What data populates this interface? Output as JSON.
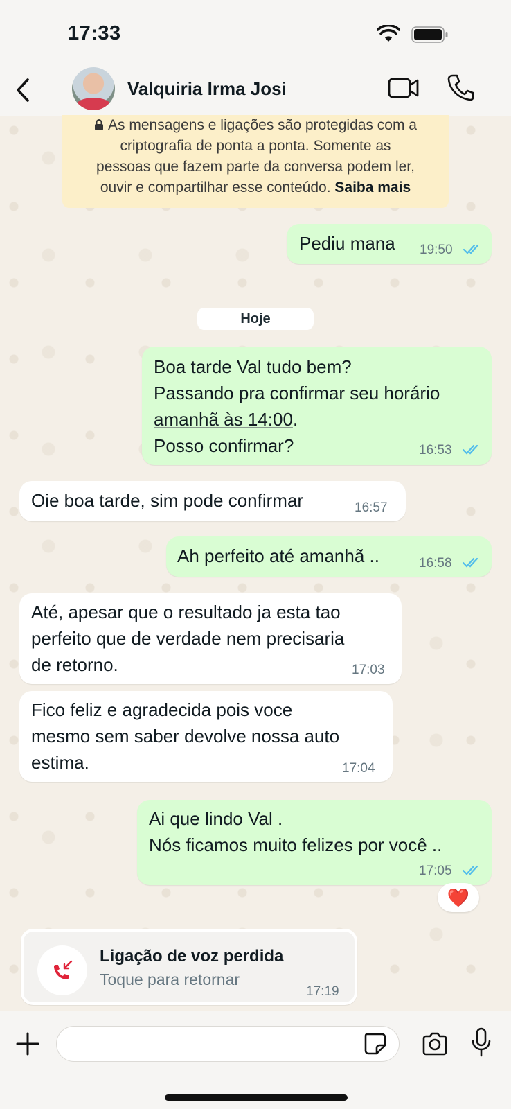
{
  "status_bar": {
    "time": "17:33"
  },
  "header": {
    "contact_name": "Valquiria Irma Josi"
  },
  "encryption_notice": {
    "line1": "As mensagens e ligações são protegidas com a",
    "line2": "criptografia de ponta a ponta. Somente as",
    "line3": "pessoas que fazem parte da conversa podem ler,",
    "line4": "ouvir e compartilhar esse conteúdo.",
    "link": "Saiba mais"
  },
  "date_separator": "Hoje",
  "messages": [
    {
      "direction": "out",
      "text": "Pediu mana",
      "time": "19:50"
    },
    {
      "direction": "out",
      "line1": "Boa tarde Val tudo bem?",
      "line2": "Passando pra confirmar seu horário",
      "line3_link": "amanhã às 14:00",
      "line3_suffix": ".",
      "line4": "Posso confirmar?",
      "time": "16:53"
    },
    {
      "direction": "in",
      "text": "Oie boa tarde, sim pode confirmar",
      "time": "16:57"
    },
    {
      "direction": "out",
      "text": "Ah perfeito até amanhã ..",
      "time": "16:58"
    },
    {
      "direction": "in",
      "text": "Até, apesar que o resultado ja esta tao\nperfeito que de verdade nem precisaria\nde retorno.",
      "time": "17:03"
    },
    {
      "direction": "in",
      "text": "Fico feliz e agradecida pois voce\nmesmo sem saber devolve nossa auto\nestima.",
      "time": "17:04"
    },
    {
      "direction": "out",
      "text": "Ai que lindo Val .\nNós ficamos muito felizes por você ..",
      "time": "17:05",
      "reaction": "❤️"
    }
  ],
  "missed_call": {
    "title": "Ligação de voz perdida",
    "subtitle": "Toque para retornar",
    "time": "17:19"
  },
  "input": {
    "placeholder": ""
  },
  "colors": {
    "outgoing_bubble": "#d9fdd3",
    "incoming_bubble": "#ffffff",
    "read_ticks": "#53bdeb",
    "notice_bg": "#fcefc9",
    "missed_call_red": "#e0243a"
  },
  "icons": [
    "back-icon",
    "video-call-icon",
    "voice-call-icon",
    "lock-icon",
    "double-check-icon",
    "missed-call-icon",
    "plus-icon",
    "sticker-icon",
    "camera-icon",
    "microphone-icon",
    "wifi-icon",
    "battery-icon"
  ]
}
